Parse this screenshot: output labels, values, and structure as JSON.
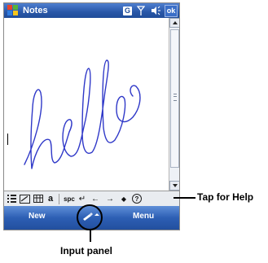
{
  "window": {
    "title": "Notes",
    "ok_label": "ok",
    "g_badge": "G"
  },
  "canvas": {
    "handwriting_text": "hello"
  },
  "toolbar": {
    "spc_label": "spc",
    "enter_symbol": "↵",
    "left_arrow": "←",
    "right_arrow": "→",
    "bullet": "◆",
    "help_symbol": "?",
    "a_label": "a"
  },
  "softkeys": {
    "left_label": "New",
    "right_label": "Menu"
  },
  "callouts": {
    "help_label": "Tap for Help",
    "input_label": "Input panel"
  },
  "icons": {
    "start": "windows-flag-icon",
    "signal": "antenna-icon",
    "volume": "speaker-icon",
    "input_panel": "keyboard-pen-icon"
  },
  "colors": {
    "titlebar": "#2957a8",
    "softkeys": "#2d5fb4",
    "ink": "#2f38c8"
  }
}
